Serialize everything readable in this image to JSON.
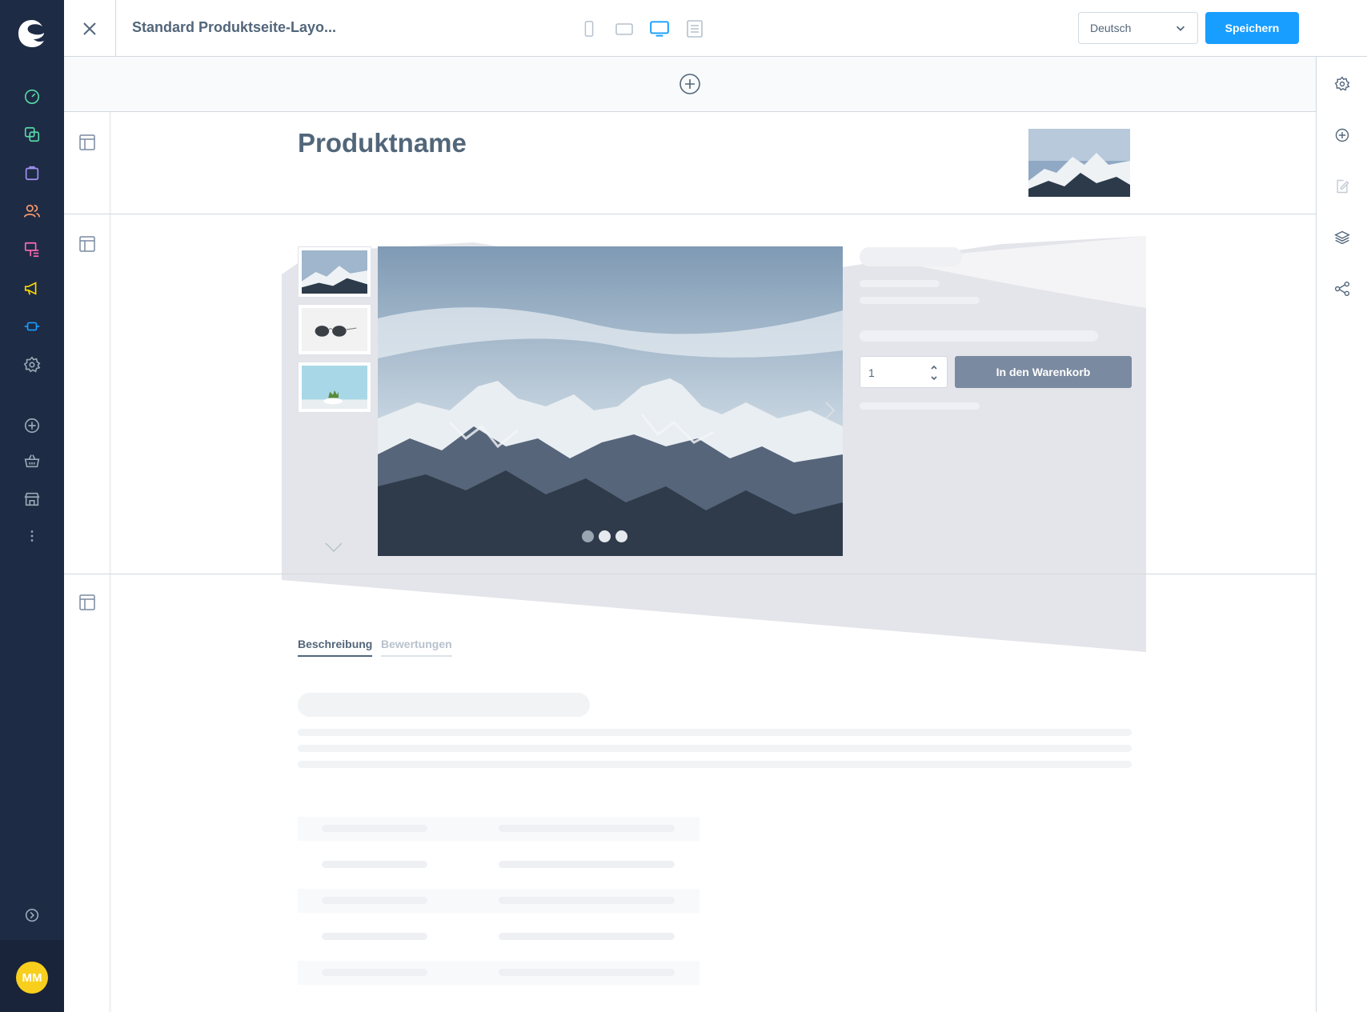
{
  "header": {
    "title": "Standard Produktseite-Layo...",
    "language": "Deutsch",
    "save_label": "Speichern"
  },
  "sidebar": {
    "avatar_initials": "MM",
    "items": [
      {
        "icon": "dashboard-icon",
        "color": "#57d9a3"
      },
      {
        "icon": "catalogue-icon",
        "color": "#57d9a3"
      },
      {
        "icon": "orders-icon",
        "color": "#a092f0"
      },
      {
        "icon": "customers-icon",
        "color": "#ff9d6c"
      },
      {
        "icon": "content-icon",
        "color": "#ff68b4"
      },
      {
        "icon": "marketing-icon",
        "color": "#ffd700"
      },
      {
        "icon": "extensions-icon",
        "color": "#189eff"
      },
      {
        "icon": "settings-icon",
        "color": "#9aa8b5"
      },
      {
        "icon": "add-icon",
        "color": "#9aa8b5"
      },
      {
        "icon": "basket-icon",
        "color": "#9aa8b5"
      },
      {
        "icon": "storefront-icon",
        "color": "#9aa8b5"
      },
      {
        "icon": "more-icon",
        "color": "#9aa8b5"
      }
    ]
  },
  "page": {
    "product_name": "Produktname",
    "quantity": "1",
    "cart_button": "In den Warenkorb",
    "tabs": [
      {
        "label": "Beschreibung",
        "active": true
      },
      {
        "label": "Bewertungen",
        "active": false
      }
    ]
  },
  "colors": {
    "accent": "#189eff",
    "sidebar_bg": "#1e2b45",
    "text": "#52667a"
  }
}
